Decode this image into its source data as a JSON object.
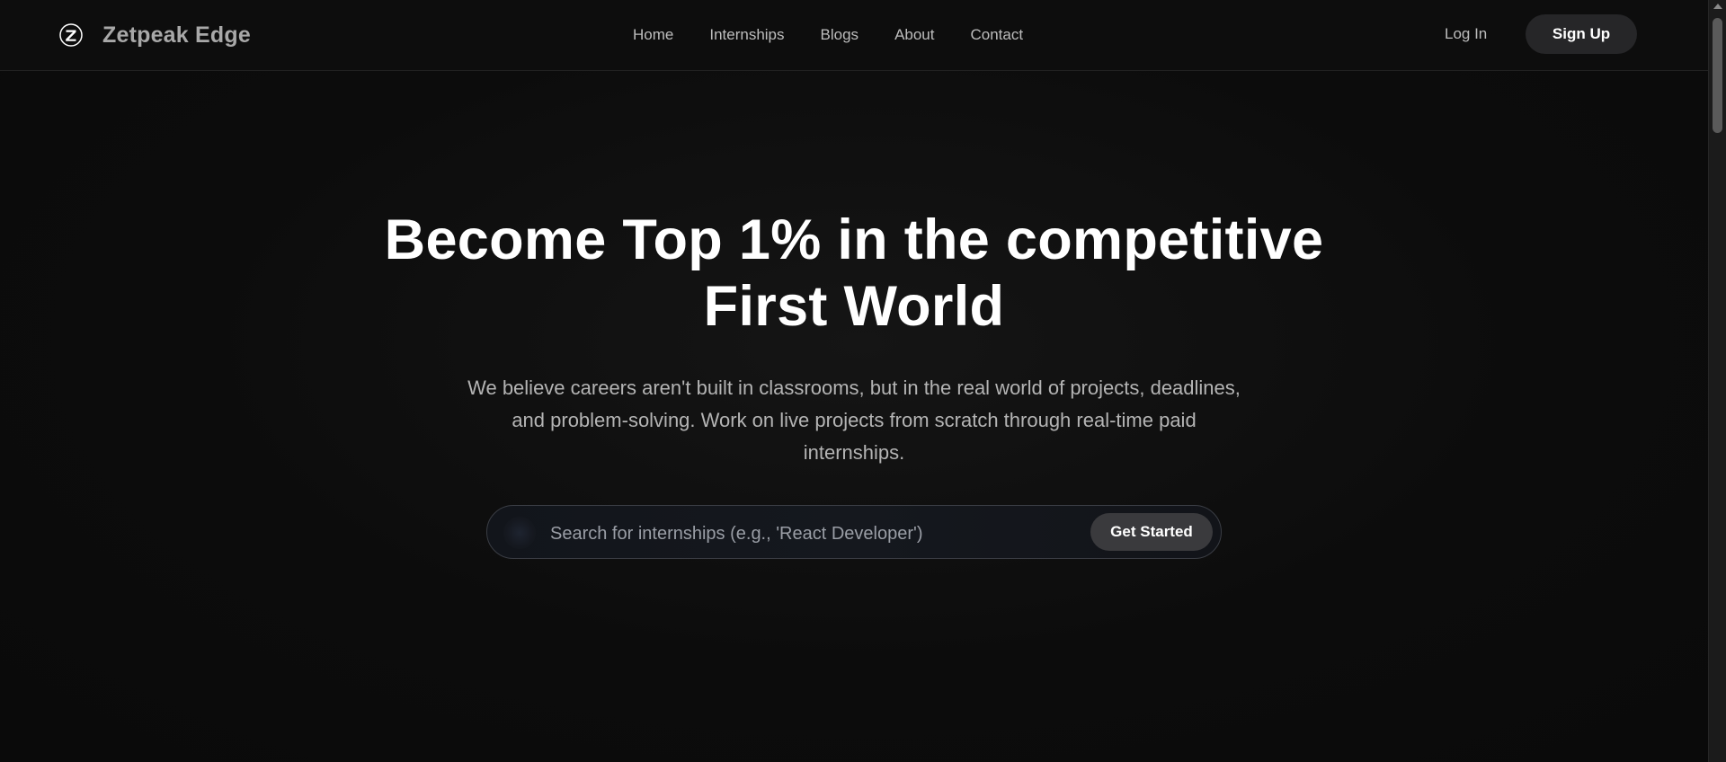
{
  "brand": {
    "logo_icon": "z-logo-icon",
    "name": "Zetpeak Edge"
  },
  "nav": {
    "items": [
      {
        "label": "Home"
      },
      {
        "label": "Internships"
      },
      {
        "label": "Blogs"
      },
      {
        "label": "About"
      },
      {
        "label": "Contact"
      }
    ],
    "login_label": "Log In",
    "signup_label": "Sign Up"
  },
  "hero": {
    "title_line1": "Become Top 1% in the competitive",
    "title_line2": "First World",
    "subtitle_line1": "We believe careers aren't built in classrooms, but in the real world of projects, deadlines,",
    "subtitle_line2": "and problem-solving. Work on live projects from scratch through real-time paid",
    "subtitle_line3": "internships."
  },
  "search": {
    "placeholder": "Search for internships (e.g., 'React Developer')",
    "value": "",
    "button_label": "Get Started"
  },
  "colors": {
    "background": "#0a0a0a",
    "signup_bg": "#262628",
    "get_started_bg": "#3a3a3d",
    "nav_text": "#bdbdbd",
    "subtitle_text": "#b4b4b4"
  }
}
